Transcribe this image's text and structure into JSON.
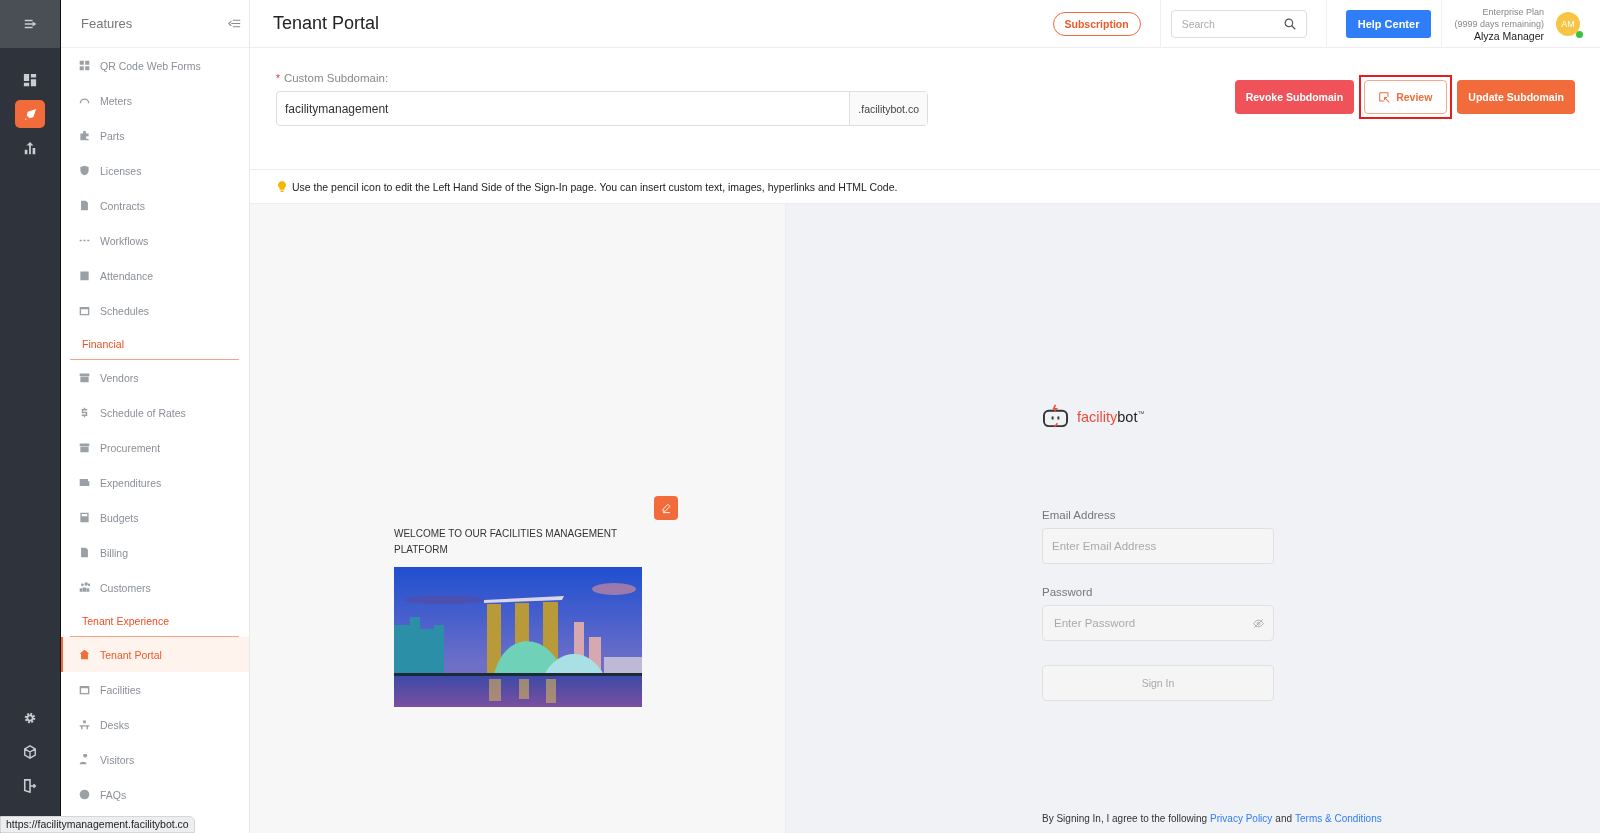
{
  "rail": {
    "items": [
      {
        "selected": false
      },
      {
        "selected": true
      },
      {
        "selected": false
      }
    ]
  },
  "sidebar": {
    "title": "Features",
    "items": [
      {
        "kind": "item",
        "label": "QR Code Web Forms",
        "selected": false
      },
      {
        "kind": "item",
        "label": "Meters",
        "selected": false
      },
      {
        "kind": "item",
        "label": "Parts",
        "selected": false
      },
      {
        "kind": "item",
        "label": "Licenses",
        "selected": false
      },
      {
        "kind": "item",
        "label": "Contracts",
        "selected": false
      },
      {
        "kind": "item",
        "label": "Workflows",
        "selected": false
      },
      {
        "kind": "item",
        "label": "Attendance",
        "selected": false
      },
      {
        "kind": "item",
        "label": "Schedules",
        "selected": false
      },
      {
        "kind": "section",
        "label": "Financial"
      },
      {
        "kind": "item",
        "label": "Vendors",
        "selected": false
      },
      {
        "kind": "item",
        "label": "Schedule of Rates",
        "selected": false
      },
      {
        "kind": "item",
        "label": "Procurement",
        "selected": false
      },
      {
        "kind": "item",
        "label": "Expenditures",
        "selected": false
      },
      {
        "kind": "item",
        "label": "Budgets",
        "selected": false
      },
      {
        "kind": "item",
        "label": "Billing",
        "selected": false
      },
      {
        "kind": "item",
        "label": "Customers",
        "selected": false
      },
      {
        "kind": "section",
        "label": "Tenant Experience"
      },
      {
        "kind": "item",
        "label": "Tenant Portal",
        "selected": true
      },
      {
        "kind": "item",
        "label": "Facilities",
        "selected": false
      },
      {
        "kind": "item",
        "label": "Desks",
        "selected": false
      },
      {
        "kind": "item",
        "label": "Visitors",
        "selected": false
      },
      {
        "kind": "item",
        "label": "FAQs",
        "selected": false
      }
    ]
  },
  "header": {
    "title": "Tenant Portal",
    "subscription": "Subscription",
    "search": {
      "placeholder": "Search"
    },
    "help": "Help Center",
    "plan": "Enterprise Plan",
    "days": "(9999 days remaining)",
    "user": "Alyza Manager",
    "avatar": "AM",
    "online": true
  },
  "subdomain": {
    "required_mark": "*",
    "label": "Custom Subdomain:",
    "value": "facilitymanagement",
    "suffix": ".facilitybot.co"
  },
  "actions": [
    {
      "kind": "danger",
      "label": "Revoke Subdomain",
      "highlighted": false
    },
    {
      "kind": "outline",
      "label": "Review",
      "highlighted": true
    },
    {
      "kind": "primary",
      "label": "Update Subdomain",
      "highlighted": false
    }
  ],
  "hint": "Use the pencil icon to edit the Left Hand Side of the Sign-In page. You can insert custom text, images, hyperlinks and HTML Code.",
  "preview": {
    "welcome": "WELCOME TO OUR FACILITIES MANAGEMENT PLATFORM",
    "logo": {
      "first": "facility",
      "second": "bot",
      "mark": "™"
    },
    "email": {
      "label": "Email Address",
      "placeholder": "Enter Email Address"
    },
    "password": {
      "label": "Password",
      "placeholder": "Enter Password"
    },
    "sign_in": {
      "label": "Sign In",
      "disabled": true
    },
    "terms": {
      "text": "By Signing In, I agree to the following",
      "privacy": "Privacy Policy",
      "and": "and",
      "conditions": "Terms & Conditions"
    }
  },
  "status_bar": {
    "url": "https://facilitymanagement.facilitybot.co"
  }
}
